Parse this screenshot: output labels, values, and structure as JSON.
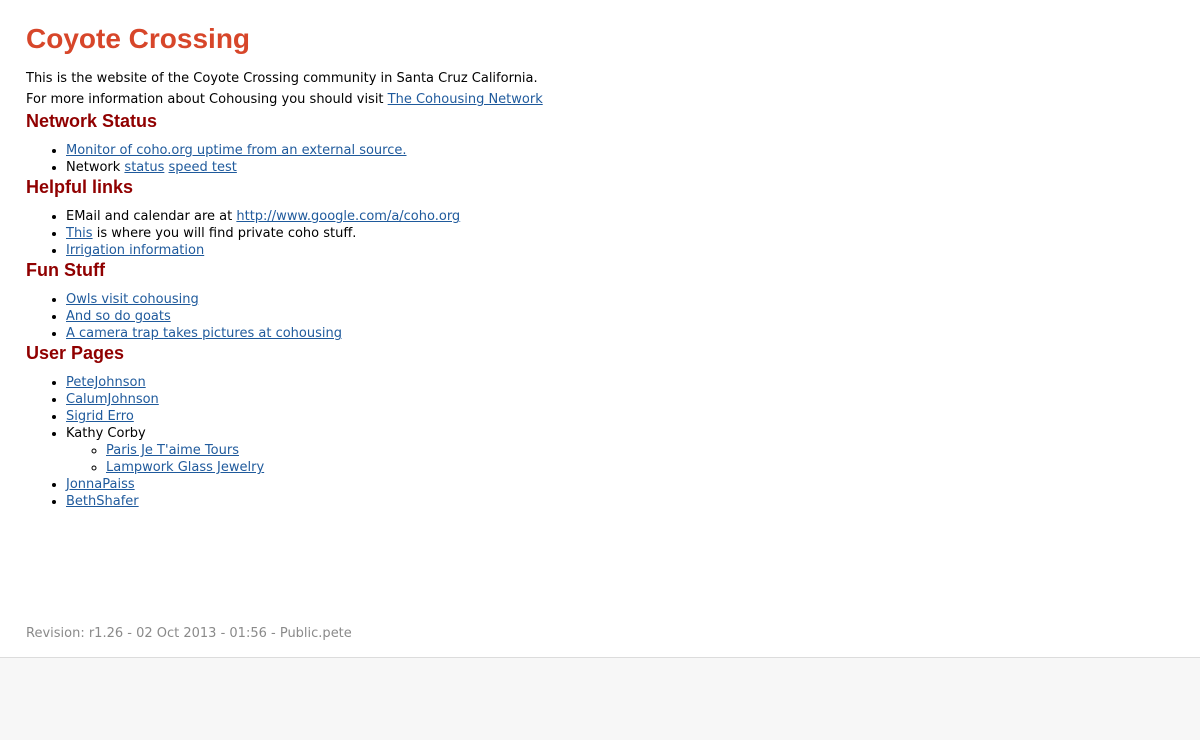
{
  "site": {
    "title": "Coyote Crossing",
    "intro_line1": "This is the website of the Coyote Crossing community in Santa Cruz California.",
    "intro_line2_prefix": "For more information about Cohousing you should visit ",
    "intro_link": "The Cohousing Network"
  },
  "network_status": {
    "heading": "Network Status",
    "monitor_link": "Monitor of coho.org uptime from an external source.",
    "network_label": "Network ",
    "status_link": "status",
    "speed_test_link": "speed test"
  },
  "helpful_links": {
    "heading": "Helpful links",
    "email_prefix": "EMail and calendar are at ",
    "email_link": "http://www.google.com/a/coho.org",
    "this_link": "This",
    "this_suffix": " is where you will find private coho stuff.",
    "irrigation_link": "Irrigation information"
  },
  "fun_stuff": {
    "heading": "Fun Stuff",
    "owls_link": "Owls visit cohousing",
    "goats_link": "And so do goats",
    "camera_link": "A camera trap takes pictures at cohousing"
  },
  "user_pages": {
    "heading": "User Pages",
    "pete": "PeteJohnson",
    "calum": "CalumJohnson",
    "sigrid": "Sigrid Erro",
    "kathy": "Kathy Corby",
    "paris": "Paris Je T'aime Tours",
    "lampwork": "Lampwork Glass Jewelry",
    "jonna": "JonnaPaiss",
    "beth": "BethShafer"
  },
  "footer": {
    "revision": "Revision: r1.26 - 02 Oct 2013 - 01:56 - Public.pete"
  },
  "colors": {
    "title": "#d7462a",
    "heading": "#900000",
    "link": "#1f5a9c",
    "revision": "#8a8a8a",
    "page_bg": "#ffffff",
    "footer_bg": "#f7f7f7"
  }
}
